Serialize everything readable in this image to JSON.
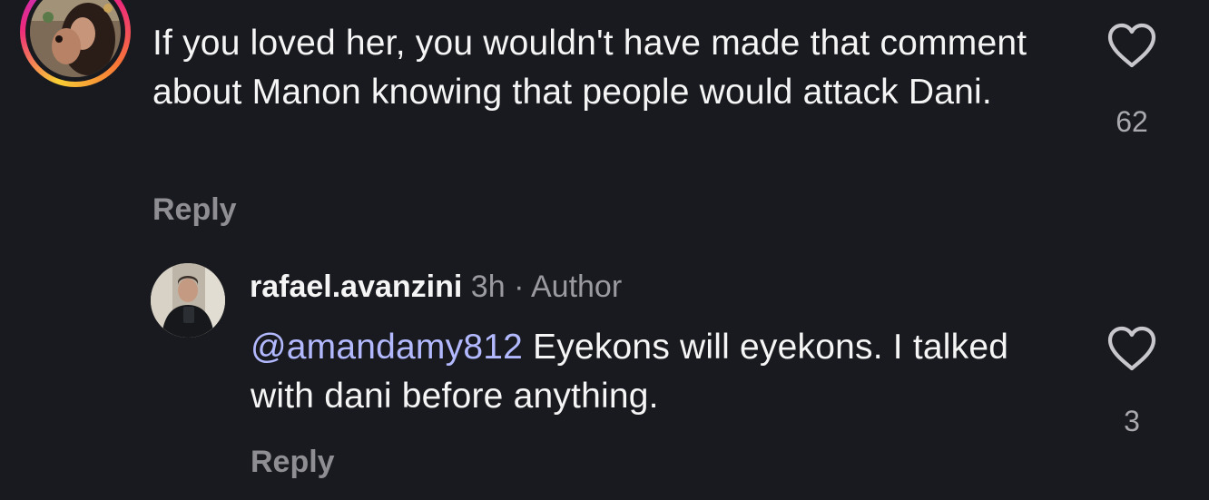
{
  "comments": [
    {
      "text": "If you loved her, you wouldn't have made that comment about Manon knowing that people would attack Dani.",
      "reply_label": "Reply",
      "like_count": "62",
      "icons": {
        "avatar": "story-ring-avatar",
        "like": "heart-outline-icon"
      }
    }
  ],
  "reply": {
    "username": "rafael.avanzini",
    "time": "3h",
    "separator": "·",
    "badge": "Author",
    "mention": "@amandamy812",
    "text": " Eyekons will eyekons. I talked with dani before anything.",
    "reply_label": "Reply",
    "like_count": "3",
    "icons": {
      "avatar": "profile-avatar",
      "like": "heart-outline-icon"
    }
  },
  "colors": {
    "background": "#181a1f",
    "primary_text": "#f5f5f5",
    "secondary_text": "#8e8e93",
    "mention": "#b3b9ff",
    "story_ring": [
      "#f9ce34",
      "#ee2a7b",
      "#b72dd1"
    ]
  }
}
